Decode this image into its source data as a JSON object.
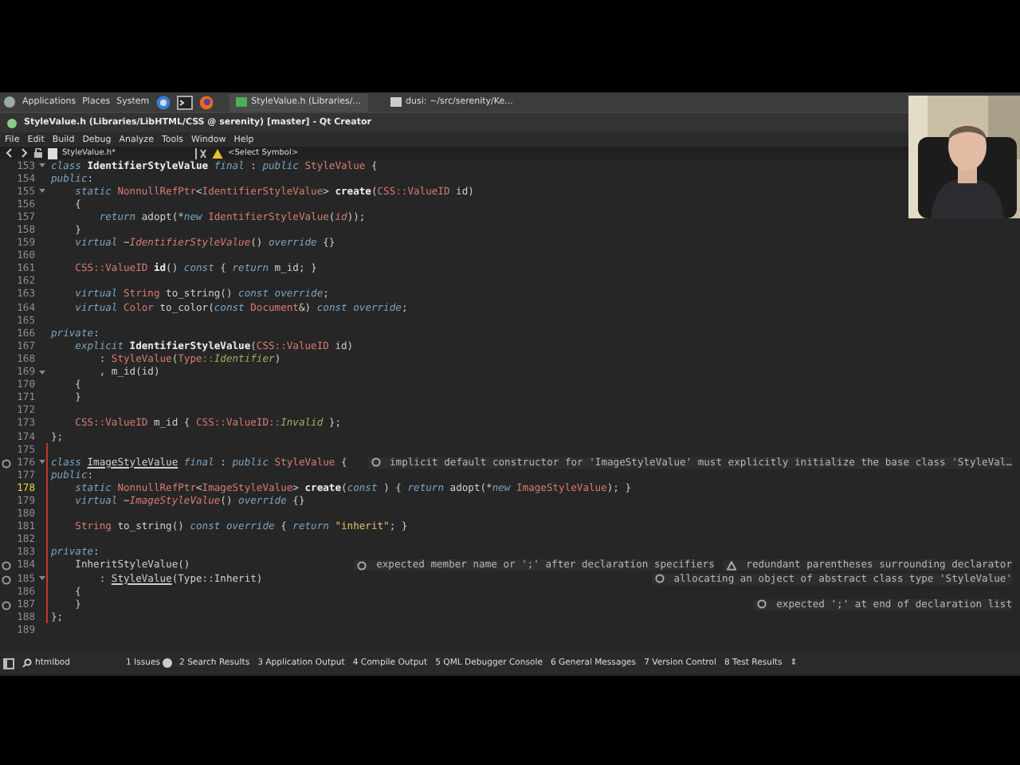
{
  "taskbar": {
    "menus": [
      "Applications",
      "Places",
      "System"
    ],
    "windows": [
      {
        "label": "StyleValue.h (Libraries/...",
        "selected": true
      },
      {
        "label": "dusi: ~/src/serenity/Ke...",
        "selected": false
      }
    ]
  },
  "window": {
    "title": "StyleValue.h (Libraries/LibHTML/CSS @ serenity) [master] - Qt Creator"
  },
  "menu": [
    "File",
    "Edit",
    "Build",
    "Debug",
    "Analyze",
    "Tools",
    "Window",
    "Help"
  ],
  "editor_toolbar": {
    "file": "StyleValue.h*",
    "symbol": "<Select Symbol>"
  },
  "lines": [
    {
      "n": "153",
      "fold": true,
      "segs": [
        {
          "t": "class ",
          "kind": "kw"
        },
        {
          "t": "IdentifierStyleValue ",
          "kind": "cl"
        },
        {
          "t": "final",
          "kind": "kw"
        },
        {
          "t": " : ",
          "kind": "pl"
        },
        {
          "t": "public ",
          "kind": "kw"
        },
        {
          "t": "StyleValue",
          "kind": "ty"
        },
        {
          "t": " {",
          "kind": "pl"
        }
      ]
    },
    {
      "n": "154",
      "segs": [
        {
          "t": "public",
          "kind": "kw"
        },
        {
          "t": ":",
          "kind": "pl"
        }
      ]
    },
    {
      "n": "155",
      "fold": true,
      "segs": [
        {
          "t": "    static ",
          "kind": "kw"
        },
        {
          "t": "NonnullRefPtr",
          "kind": "ty"
        },
        {
          "t": "<",
          "kind": "pl"
        },
        {
          "t": "IdentifierStyleValue",
          "kind": "ty"
        },
        {
          "t": "> ",
          "kind": "pl"
        },
        {
          "t": "create",
          "kind": "fn"
        },
        {
          "t": "(",
          "kind": "pl"
        },
        {
          "t": "CSS::ValueID",
          "kind": "ty"
        },
        {
          "t": " id)",
          "kind": "pl"
        }
      ]
    },
    {
      "n": "156",
      "segs": [
        {
          "t": "    {",
          "kind": "pl"
        }
      ]
    },
    {
      "n": "157",
      "segs": [
        {
          "t": "        return",
          "kind": "kw"
        },
        {
          "t": " adopt(*",
          "kind": "pl"
        },
        {
          "t": "new ",
          "kind": "kw"
        },
        {
          "t": "IdentifierStyleValue",
          "kind": "ty"
        },
        {
          "t": "(",
          "kind": "pl"
        },
        {
          "t": "id",
          "kind": "it"
        },
        {
          "t": "));",
          "kind": "pl"
        }
      ]
    },
    {
      "n": "158",
      "segs": [
        {
          "t": "    }",
          "kind": "pl"
        }
      ]
    },
    {
      "n": "159",
      "segs": [
        {
          "t": "    virtual",
          "kind": "kw"
        },
        {
          "t": " ~",
          "kind": "pl"
        },
        {
          "t": "IdentifierStyleValue",
          "kind": "tyi"
        },
        {
          "t": "() ",
          "kind": "pl"
        },
        {
          "t": "override",
          "kind": "kw"
        },
        {
          "t": " {}",
          "kind": "pl"
        }
      ]
    },
    {
      "n": "160"
    },
    {
      "n": "161",
      "segs": [
        {
          "t": "    CSS::ValueID ",
          "kind": "ty"
        },
        {
          "t": "id",
          "kind": "fn"
        },
        {
          "t": "() ",
          "kind": "pl"
        },
        {
          "t": "const",
          "kind": "kw"
        },
        {
          "t": " { ",
          "kind": "pl"
        },
        {
          "t": "return",
          "kind": "kw"
        },
        {
          "t": " m_id; }",
          "kind": "pl"
        }
      ]
    },
    {
      "n": "162"
    },
    {
      "n": "163",
      "segs": [
        {
          "t": "    virtual ",
          "kind": "kw"
        },
        {
          "t": "String",
          "kind": "ty"
        },
        {
          "t": " to_string() ",
          "kind": "pl"
        },
        {
          "t": "const override",
          "kind": "kw"
        },
        {
          "t": ";",
          "kind": "pl"
        }
      ]
    },
    {
      "n": "164",
      "segs": [
        {
          "t": "    virtual ",
          "kind": "kw"
        },
        {
          "t": "Color",
          "kind": "ty"
        },
        {
          "t": " to_color(",
          "kind": "pl"
        },
        {
          "t": "const ",
          "kind": "kw"
        },
        {
          "t": "Document",
          "kind": "ty"
        },
        {
          "t": "&) ",
          "kind": "pl"
        },
        {
          "t": "const override",
          "kind": "kw"
        },
        {
          "t": ";",
          "kind": "pl"
        }
      ]
    },
    {
      "n": "165"
    },
    {
      "n": "166",
      "segs": [
        {
          "t": "private",
          "kind": "kw"
        },
        {
          "t": ":",
          "kind": "pl"
        }
      ]
    },
    {
      "n": "167",
      "segs": [
        {
          "t": "    explicit ",
          "kind": "kw"
        },
        {
          "t": "IdentifierStyleValue",
          "kind": "cl"
        },
        {
          "t": "(",
          "kind": "pl"
        },
        {
          "t": "CSS::ValueID",
          "kind": "ty"
        },
        {
          "t": " id)",
          "kind": "pl"
        }
      ]
    },
    {
      "n": "168",
      "segs": [
        {
          "t": "        : ",
          "kind": "pl"
        },
        {
          "t": "StyleValue",
          "kind": "ty"
        },
        {
          "t": "(",
          "kind": "pl"
        },
        {
          "t": "Type::",
          "kind": "ty"
        },
        {
          "t": "Identifier",
          "kind": "en"
        },
        {
          "t": ")",
          "kind": "pl"
        }
      ]
    },
    {
      "n": "169",
      "fold": true,
      "segs": [
        {
          "t": "        , m_id(id)",
          "kind": "pl"
        }
      ]
    },
    {
      "n": "170",
      "segs": [
        {
          "t": "    {",
          "kind": "pl"
        }
      ]
    },
    {
      "n": "171",
      "segs": [
        {
          "t": "    }",
          "kind": "pl"
        }
      ]
    },
    {
      "n": "172"
    },
    {
      "n": "173",
      "segs": [
        {
          "t": "    CSS::ValueID",
          "kind": "ty"
        },
        {
          "t": " m_id { ",
          "kind": "pl"
        },
        {
          "t": "CSS::ValueID::",
          "kind": "ty"
        },
        {
          "t": "Invalid",
          "kind": "en"
        },
        {
          "t": " };",
          "kind": "pl"
        }
      ]
    },
    {
      "n": "174",
      "segs": [
        {
          "t": "};",
          "kind": "pl"
        }
      ]
    },
    {
      "n": "175",
      "changed": true
    },
    {
      "n": "176",
      "changed": true,
      "fold": true,
      "issue": true,
      "segs": [
        {
          "t": "class ",
          "kind": "kw"
        },
        {
          "t": "ImageStyleValue",
          "kind": "ul"
        },
        {
          "t": " final",
          "kind": "kw"
        },
        {
          "t": " : ",
          "kind": "pl"
        },
        {
          "t": "public ",
          "kind": "kw"
        },
        {
          "t": "StyleValue",
          "kind": "ty"
        },
        {
          "t": " {",
          "kind": "pl"
        }
      ],
      "notes": [
        {
          "kind": "error",
          "text": "implicit default constructor for 'ImageStyleValue' must explicitly initialize the base class 'StyleVal…"
        }
      ]
    },
    {
      "n": "177",
      "changed": true,
      "segs": [
        {
          "t": "public",
          "kind": "kw"
        },
        {
          "t": ":",
          "kind": "pl"
        }
      ]
    },
    {
      "n": "178",
      "changed": true,
      "current": true,
      "segs": [
        {
          "t": "    static ",
          "kind": "kw"
        },
        {
          "t": "NonnullRefPtr",
          "kind": "ty"
        },
        {
          "t": "<",
          "kind": "pl"
        },
        {
          "t": "ImageStyleValue",
          "kind": "ty"
        },
        {
          "t": "> ",
          "kind": "pl"
        },
        {
          "t": "create",
          "kind": "fn"
        },
        {
          "t": "(",
          "kind": "pl"
        },
        {
          "t": "const",
          "kind": "kw"
        },
        {
          "t": " ) { ",
          "kind": "pl"
        },
        {
          "t": "return",
          "kind": "kw"
        },
        {
          "t": " adopt(*",
          "kind": "pl"
        },
        {
          "t": "new ",
          "kind": "kw"
        },
        {
          "t": "ImageStyleValue",
          "kind": "ty"
        },
        {
          "t": "); }",
          "kind": "pl"
        }
      ]
    },
    {
      "n": "179",
      "changed": true,
      "segs": [
        {
          "t": "    virtual",
          "kind": "kw"
        },
        {
          "t": " ~",
          "kind": "pl"
        },
        {
          "t": "ImageStyleValue",
          "kind": "tyi"
        },
        {
          "t": "() ",
          "kind": "pl"
        },
        {
          "t": "override",
          "kind": "kw"
        },
        {
          "t": " {}",
          "kind": "pl"
        }
      ]
    },
    {
      "n": "180",
      "changed": true
    },
    {
      "n": "181",
      "changed": true,
      "segs": [
        {
          "t": "    String",
          "kind": "ty"
        },
        {
          "t": " to_string() ",
          "kind": "pl"
        },
        {
          "t": "const override",
          "kind": "kw"
        },
        {
          "t": " { ",
          "kind": "pl"
        },
        {
          "t": "return ",
          "kind": "kw"
        },
        {
          "t": "\"inherit\"",
          "kind": "st"
        },
        {
          "t": "; }",
          "kind": "pl"
        }
      ]
    },
    {
      "n": "182",
      "changed": true
    },
    {
      "n": "183",
      "changed": true,
      "segs": [
        {
          "t": "private",
          "kind": "kw"
        },
        {
          "t": ":",
          "kind": "pl"
        }
      ]
    },
    {
      "n": "184",
      "changed": true,
      "issue": true,
      "segs": [
        {
          "t": "    InheritStyleValue()",
          "kind": "pl"
        }
      ],
      "notes": [
        {
          "kind": "error",
          "text": "expected member name or ';' after declaration specifiers"
        },
        {
          "kind": "warning",
          "text": "redundant parentheses surrounding declarator"
        }
      ]
    },
    {
      "n": "185",
      "changed": true,
      "fold": true,
      "issue": true,
      "segs": [
        {
          "t": "        : ",
          "kind": "pl"
        },
        {
          "t": "StyleValue",
          "kind": "ul"
        },
        {
          "t": "(Type::Inherit)",
          "kind": "pl"
        }
      ],
      "notes": [
        {
          "kind": "error",
          "text": "allocating an object of abstract class type 'StyleValue'"
        }
      ]
    },
    {
      "n": "186",
      "changed": true,
      "segs": [
        {
          "t": "    {",
          "kind": "pl"
        }
      ]
    },
    {
      "n": "187",
      "changed": true,
      "issue": true,
      "segs": [
        {
          "t": "    }",
          "kind": "pl"
        }
      ],
      "notes": [
        {
          "kind": "error",
          "text": "expected ';' at end of declaration list"
        }
      ]
    },
    {
      "n": "188",
      "changed": true,
      "segs": [
        {
          "t": "};",
          "kind": "pl"
        }
      ]
    },
    {
      "n": "189"
    }
  ],
  "output_bar": {
    "locator": "htmlbod",
    "tabs": [
      {
        "label": "1 Issues",
        "badge": true
      },
      {
        "label": "2 Search Results"
      },
      {
        "label": "3 Application Output"
      },
      {
        "label": "4 Compile Output"
      },
      {
        "label": "5 QML Debugger Console"
      },
      {
        "label": "6 General Messages"
      },
      {
        "label": "7 Version Control"
      },
      {
        "label": "8 Test Results"
      }
    ],
    "more": "⇕"
  },
  "webcam": {
    "kind": "picture"
  }
}
